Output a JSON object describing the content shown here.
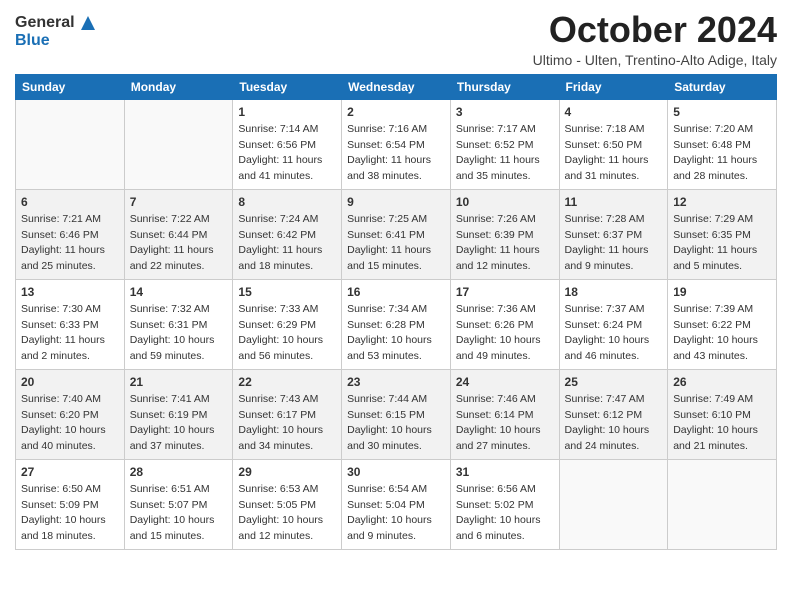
{
  "logo": {
    "line1": "General",
    "line2": "Blue"
  },
  "title": "October 2024",
  "subtitle": "Ultimo - Ulten, Trentino-Alto Adige, Italy",
  "weekdays": [
    "Sunday",
    "Monday",
    "Tuesday",
    "Wednesday",
    "Thursday",
    "Friday",
    "Saturday"
  ],
  "weeks": [
    [
      {
        "day": "",
        "info": ""
      },
      {
        "day": "",
        "info": ""
      },
      {
        "day": "1",
        "info": "Sunrise: 7:14 AM\nSunset: 6:56 PM\nDaylight: 11 hours and 41 minutes."
      },
      {
        "day": "2",
        "info": "Sunrise: 7:16 AM\nSunset: 6:54 PM\nDaylight: 11 hours and 38 minutes."
      },
      {
        "day": "3",
        "info": "Sunrise: 7:17 AM\nSunset: 6:52 PM\nDaylight: 11 hours and 35 minutes."
      },
      {
        "day": "4",
        "info": "Sunrise: 7:18 AM\nSunset: 6:50 PM\nDaylight: 11 hours and 31 minutes."
      },
      {
        "day": "5",
        "info": "Sunrise: 7:20 AM\nSunset: 6:48 PM\nDaylight: 11 hours and 28 minutes."
      }
    ],
    [
      {
        "day": "6",
        "info": "Sunrise: 7:21 AM\nSunset: 6:46 PM\nDaylight: 11 hours and 25 minutes."
      },
      {
        "day": "7",
        "info": "Sunrise: 7:22 AM\nSunset: 6:44 PM\nDaylight: 11 hours and 22 minutes."
      },
      {
        "day": "8",
        "info": "Sunrise: 7:24 AM\nSunset: 6:42 PM\nDaylight: 11 hours and 18 minutes."
      },
      {
        "day": "9",
        "info": "Sunrise: 7:25 AM\nSunset: 6:41 PM\nDaylight: 11 hours and 15 minutes."
      },
      {
        "day": "10",
        "info": "Sunrise: 7:26 AM\nSunset: 6:39 PM\nDaylight: 11 hours and 12 minutes."
      },
      {
        "day": "11",
        "info": "Sunrise: 7:28 AM\nSunset: 6:37 PM\nDaylight: 11 hours and 9 minutes."
      },
      {
        "day": "12",
        "info": "Sunrise: 7:29 AM\nSunset: 6:35 PM\nDaylight: 11 hours and 5 minutes."
      }
    ],
    [
      {
        "day": "13",
        "info": "Sunrise: 7:30 AM\nSunset: 6:33 PM\nDaylight: 11 hours and 2 minutes."
      },
      {
        "day": "14",
        "info": "Sunrise: 7:32 AM\nSunset: 6:31 PM\nDaylight: 10 hours and 59 minutes."
      },
      {
        "day": "15",
        "info": "Sunrise: 7:33 AM\nSunset: 6:29 PM\nDaylight: 10 hours and 56 minutes."
      },
      {
        "day": "16",
        "info": "Sunrise: 7:34 AM\nSunset: 6:28 PM\nDaylight: 10 hours and 53 minutes."
      },
      {
        "day": "17",
        "info": "Sunrise: 7:36 AM\nSunset: 6:26 PM\nDaylight: 10 hours and 49 minutes."
      },
      {
        "day": "18",
        "info": "Sunrise: 7:37 AM\nSunset: 6:24 PM\nDaylight: 10 hours and 46 minutes."
      },
      {
        "day": "19",
        "info": "Sunrise: 7:39 AM\nSunset: 6:22 PM\nDaylight: 10 hours and 43 minutes."
      }
    ],
    [
      {
        "day": "20",
        "info": "Sunrise: 7:40 AM\nSunset: 6:20 PM\nDaylight: 10 hours and 40 minutes."
      },
      {
        "day": "21",
        "info": "Sunrise: 7:41 AM\nSunset: 6:19 PM\nDaylight: 10 hours and 37 minutes."
      },
      {
        "day": "22",
        "info": "Sunrise: 7:43 AM\nSunset: 6:17 PM\nDaylight: 10 hours and 34 minutes."
      },
      {
        "day": "23",
        "info": "Sunrise: 7:44 AM\nSunset: 6:15 PM\nDaylight: 10 hours and 30 minutes."
      },
      {
        "day": "24",
        "info": "Sunrise: 7:46 AM\nSunset: 6:14 PM\nDaylight: 10 hours and 27 minutes."
      },
      {
        "day": "25",
        "info": "Sunrise: 7:47 AM\nSunset: 6:12 PM\nDaylight: 10 hours and 24 minutes."
      },
      {
        "day": "26",
        "info": "Sunrise: 7:49 AM\nSunset: 6:10 PM\nDaylight: 10 hours and 21 minutes."
      }
    ],
    [
      {
        "day": "27",
        "info": "Sunrise: 6:50 AM\nSunset: 5:09 PM\nDaylight: 10 hours and 18 minutes."
      },
      {
        "day": "28",
        "info": "Sunrise: 6:51 AM\nSunset: 5:07 PM\nDaylight: 10 hours and 15 minutes."
      },
      {
        "day": "29",
        "info": "Sunrise: 6:53 AM\nSunset: 5:05 PM\nDaylight: 10 hours and 12 minutes."
      },
      {
        "day": "30",
        "info": "Sunrise: 6:54 AM\nSunset: 5:04 PM\nDaylight: 10 hours and 9 minutes."
      },
      {
        "day": "31",
        "info": "Sunrise: 6:56 AM\nSunset: 5:02 PM\nDaylight: 10 hours and 6 minutes."
      },
      {
        "day": "",
        "info": ""
      },
      {
        "day": "",
        "info": ""
      }
    ]
  ]
}
